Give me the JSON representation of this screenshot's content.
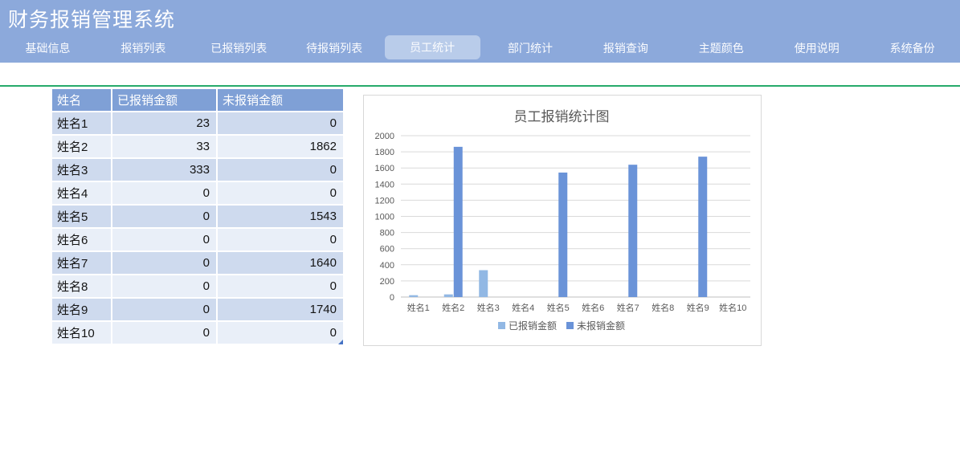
{
  "app": {
    "title": "财务报销管理系统"
  },
  "nav": {
    "items": [
      {
        "key": "basic-info",
        "label": "基础信息",
        "active": false
      },
      {
        "key": "reimburse-list",
        "label": "报销列表",
        "active": false
      },
      {
        "key": "reimbursed-list",
        "label": "已报销列表",
        "active": false
      },
      {
        "key": "pending-list",
        "label": "待报销列表",
        "active": false
      },
      {
        "key": "employee-stats",
        "label": "员工统计",
        "active": true
      },
      {
        "key": "department-stats",
        "label": "部门统计",
        "active": false
      },
      {
        "key": "reimburse-query",
        "label": "报销查询",
        "active": false
      },
      {
        "key": "theme-color",
        "label": "主题颜色",
        "active": false
      },
      {
        "key": "usage-help",
        "label": "使用说明",
        "active": false
      },
      {
        "key": "system-backup",
        "label": "系统备份",
        "active": false
      }
    ]
  },
  "table": {
    "columns": [
      "姓名",
      "已报销金额",
      "未报销金额"
    ],
    "rows": [
      {
        "name": "姓名1",
        "reimbursed": 23,
        "unreimbursed": 0
      },
      {
        "name": "姓名2",
        "reimbursed": 33,
        "unreimbursed": 1862
      },
      {
        "name": "姓名3",
        "reimbursed": 333,
        "unreimbursed": 0
      },
      {
        "name": "姓名4",
        "reimbursed": 0,
        "unreimbursed": 0
      },
      {
        "name": "姓名5",
        "reimbursed": 0,
        "unreimbursed": 1543
      },
      {
        "name": "姓名6",
        "reimbursed": 0,
        "unreimbursed": 0
      },
      {
        "name": "姓名7",
        "reimbursed": 0,
        "unreimbursed": 1640
      },
      {
        "name": "姓名8",
        "reimbursed": 0,
        "unreimbursed": 0
      },
      {
        "name": "姓名9",
        "reimbursed": 0,
        "unreimbursed": 1740
      },
      {
        "name": "姓名10",
        "reimbursed": 0,
        "unreimbursed": 0
      }
    ]
  },
  "chart_data": {
    "type": "bar",
    "title": "员工报销统计图",
    "categories": [
      "姓名1",
      "姓名2",
      "姓名3",
      "姓名4",
      "姓名5",
      "姓名6",
      "姓名7",
      "姓名8",
      "姓名9",
      "姓名10"
    ],
    "series": [
      {
        "name": "已报销金额",
        "color": "#92B8E4",
        "values": [
          23,
          33,
          333,
          0,
          0,
          0,
          0,
          0,
          0,
          0
        ]
      },
      {
        "name": "未报销金额",
        "color": "#6A93D8",
        "values": [
          0,
          1862,
          0,
          0,
          1543,
          0,
          1640,
          0,
          1740,
          0
        ]
      }
    ],
    "xlabel": "",
    "ylabel": "",
    "ylim": [
      0,
      2000
    ],
    "ytick_step": 200,
    "grid": true,
    "legend_position": "bottom"
  },
  "colors": {
    "header_bg": "#8CA9DB",
    "active_tab_bg": "#B9CCEA",
    "table_header_bg": "#7FA0D6",
    "row_odd_bg": "#CEDAEE",
    "row_even_bg": "#E9EFF8",
    "divider_green": "#27AA6B",
    "series_reimbursed": "#92B8E4",
    "series_unreimbursed": "#6A93D8",
    "chart_text": "#595959",
    "gridline": "#D9D9D9",
    "axis_line": "#BFBFBF"
  }
}
